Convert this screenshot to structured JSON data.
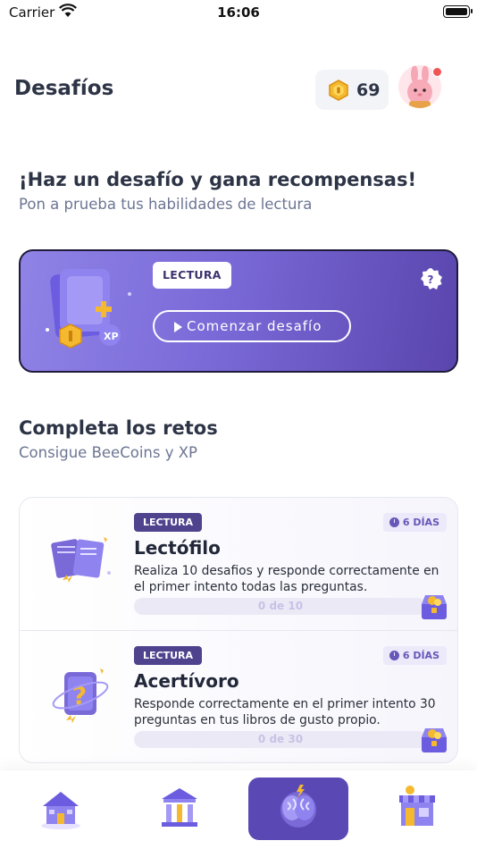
{
  "status_bar": {
    "carrier": "Carrier",
    "time": "16:06"
  },
  "header": {
    "title": "Desafíos",
    "coins": "69"
  },
  "intro": {
    "title": "¡Haz un desafío y gana recompensas!",
    "subtitle": "Pon a prueba tus habilidades de lectura"
  },
  "challenge": {
    "tag": "LECTURA",
    "start_label": "Comenzar desafío"
  },
  "quests_section": {
    "title": "Completa los retos",
    "subtitle": "Consigue BeeCoins y XP"
  },
  "quests": [
    {
      "tag": "LECTURA",
      "days": "6 DÍAS",
      "title": "Lectófilo",
      "description": "Realiza 10 desafios y responde correctamente en el primer intento todas las preguntas.",
      "progress_text": "0 de 10",
      "progress": 0
    },
    {
      "tag": "LECTURA",
      "days": "6 DÍAS",
      "title": "Acertívoro",
      "description": "Responde correctamente en el primer intento 30 preguntas en tus libros de gusto propio.",
      "progress_text": "0 de 30",
      "progress": 0
    }
  ],
  "tabbar": {
    "items": [
      {
        "icon": "home-icon",
        "active": false
      },
      {
        "icon": "library-icon",
        "active": false
      },
      {
        "icon": "brain-icon",
        "active": true
      },
      {
        "icon": "store-icon",
        "active": false
      }
    ]
  },
  "colors": {
    "accent": "#5a48b4",
    "card_gradient_start": "#8f83e6",
    "card_gradient_end": "#5a45ad",
    "tag_dark": "#4f438e"
  }
}
